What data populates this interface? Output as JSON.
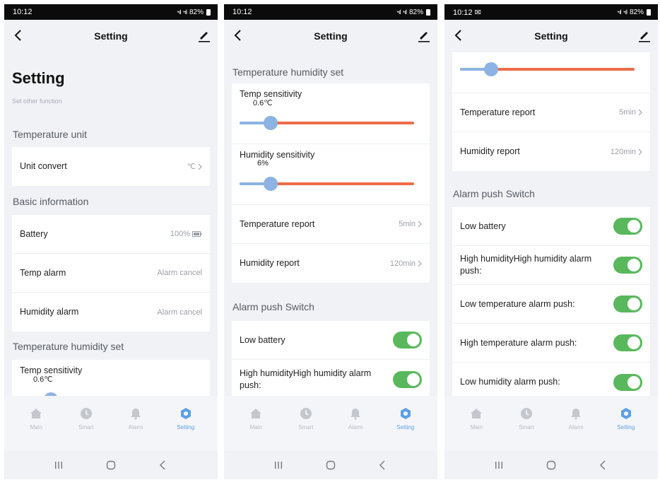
{
  "screens": [
    {
      "status": {
        "time": "10:12",
        "battery": "82%"
      },
      "header": {
        "title": "Setting"
      },
      "page_title": "Setting",
      "subtitle": "Set other function",
      "sections": {
        "temp_unit": "Temperature unit",
        "basic_info": "Basic information",
        "temp_hum_set": "Temperature humidity set"
      },
      "unit_convert": {
        "label": "Unit convert",
        "value": "℃"
      },
      "battery": {
        "label": "Battery",
        "value": "100%",
        "level_percent": 100
      },
      "temp_alarm": {
        "label": "Temp alarm",
        "value": "Alarm cancel"
      },
      "humidity_alarm": {
        "label": "Humidity alarm",
        "value": "Alarm cancel"
      },
      "temp_sensitivity": {
        "label": "Temp sensitivity",
        "value": "0.6℃",
        "position_fraction": 0.18
      }
    },
    {
      "status": {
        "time": "10:12",
        "battery": "82%"
      },
      "header": {
        "title": "Setting"
      },
      "sections": {
        "temp_hum_set": "Temperature humidity set",
        "alarm_push": "Alarm push Switch"
      },
      "temp_sensitivity": {
        "label": "Temp sensitivity",
        "value": "0.6℃",
        "position_fraction": 0.18
      },
      "humidity_sensitivity": {
        "label": "Humidity sensitivity",
        "value": "6%",
        "position_fraction": 0.18
      },
      "temperature_report": {
        "label": "Temperature report",
        "value": "5min"
      },
      "humidity_report": {
        "label": "Humidity report",
        "value": "120min"
      },
      "low_battery": {
        "label": "Low battery",
        "on": true
      },
      "high_humidity": {
        "label": "High humidityHigh humidity alarm push:",
        "on": true
      }
    },
    {
      "status": {
        "time": "10:12",
        "battery": "82%"
      },
      "header": {
        "title": "Setting"
      },
      "sections": {
        "alarm_push": "Alarm push Switch"
      },
      "humidity_sensitivity": {
        "position_fraction": 0.18
      },
      "temperature_report": {
        "label": "Temperature report",
        "value": "5min"
      },
      "humidity_report": {
        "label": "Humidity report",
        "value": "120min"
      },
      "low_battery": {
        "label": "Low battery",
        "on": true
      },
      "high_humidity": {
        "label": "High humidityHigh humidity alarm push:",
        "on": true
      },
      "low_temp": {
        "label": "Low temperature alarm push:",
        "on": true
      },
      "high_temp": {
        "label": "High temperature alarm push:",
        "on": true
      },
      "low_humidity": {
        "label": "Low humidity alarm push:",
        "on": true
      }
    }
  ],
  "tabs": [
    {
      "label": "Main",
      "icon": "home-icon"
    },
    {
      "label": "Smart",
      "icon": "clock-icon"
    },
    {
      "label": "Alarm",
      "icon": "bell-icon"
    },
    {
      "label": "Setting",
      "icon": "gear-icon",
      "active": true
    }
  ],
  "colors": {
    "accent_blue": "#5aa0e6",
    "slider_fill": "#8cb3e3",
    "slider_track": "#ee6c48",
    "toggle_on": "#59b85c"
  }
}
